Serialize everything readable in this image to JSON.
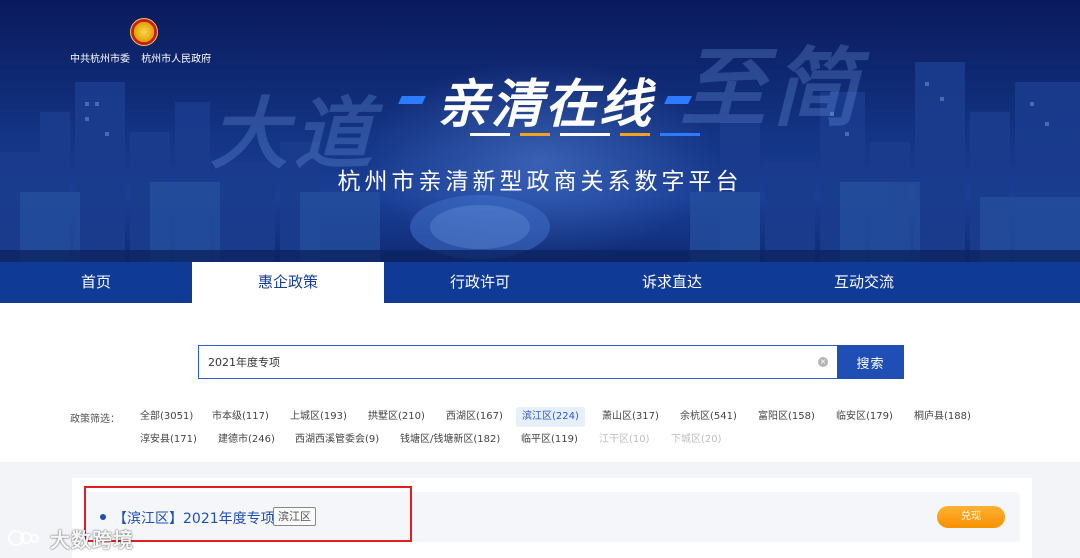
{
  "banner": {
    "gov_units": [
      "中共杭州市委",
      "杭州市人民政府"
    ],
    "bg_left": "大道",
    "bg_right": "至简",
    "main_title": "亲清在线",
    "subtitle": "杭州市亲清新型政商关系数字平台"
  },
  "nav": {
    "items": [
      {
        "label": "首页",
        "active": false
      },
      {
        "label": "惠企政策",
        "active": true
      },
      {
        "label": "行政许可",
        "active": false
      },
      {
        "label": "诉求直达",
        "active": false
      },
      {
        "label": "互动交流",
        "active": false
      }
    ]
  },
  "search": {
    "value": "2021年度专项",
    "clear_symbol": "×",
    "button_label": "搜索"
  },
  "filters": {
    "label": "政策筛选：",
    "row1": [
      "全部(3051)",
      "市本级(117)",
      "上城区(193)",
      "拱墅区(210)",
      "西湖区(167)",
      "滨江区(224)",
      "萧山区(317)",
      "余杭区(541)",
      "富阳区(158)",
      "临安区(179)",
      "桐庐县(188)"
    ],
    "row2": [
      "淳安县(171)",
      "建德市(246)",
      "西湖西溪管委会(9)",
      "钱塘区/钱塘新区(182)",
      "临平区(119)",
      "江干区(10)",
      "下城区(20)"
    ],
    "active": "滨江区(224)",
    "dim": [
      "江干区(10)",
      "下城区(20)"
    ]
  },
  "result": {
    "title": "【滨江区】2021年度专项",
    "tag": "滨江区",
    "action_label": "兑现"
  },
  "watermark": {
    "text": "大数跨境"
  },
  "colors": {
    "nav_bg": "#0f3b96",
    "accent_blue": "#1f4fb4",
    "highlight_red": "#e02020",
    "claim_orange": "#f79100"
  }
}
